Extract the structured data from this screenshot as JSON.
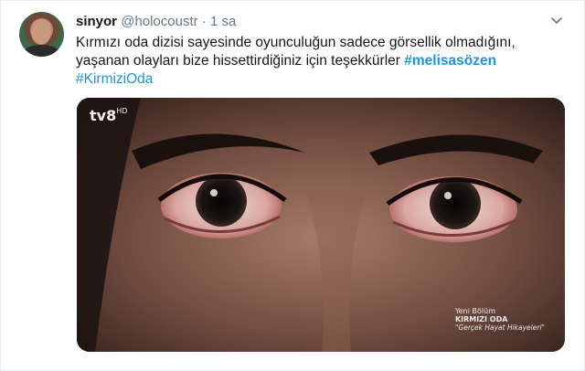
{
  "tweet": {
    "display_name": "sinyor",
    "handle": "@holocoustr",
    "separator": "·",
    "time": "1 sa",
    "text_line1": "Kırmızı oda dizisi sayesinde oyunculuğun sadece görsellik olmadığını,",
    "text_line2_plain": "yaşanan olayları bize hissettirdiğiniz için teşekkürler ",
    "hashtag1": "#melisasözen",
    "hashtag2": "#KirmiziOda"
  },
  "media": {
    "channel_logo": "tv8",
    "channel_logo_sup": "HD",
    "caption_line1": "Yeni Bölüm",
    "caption_line2": "KIRMIZI ODA",
    "caption_line3": "\"Gerçek Hayat Hikayeleri\""
  },
  "icons": {
    "menu": "chevron-down-icon",
    "avatar": "avatar"
  },
  "colors": {
    "link": "#1b95e0",
    "text": "#14171a",
    "muted": "#657786"
  }
}
